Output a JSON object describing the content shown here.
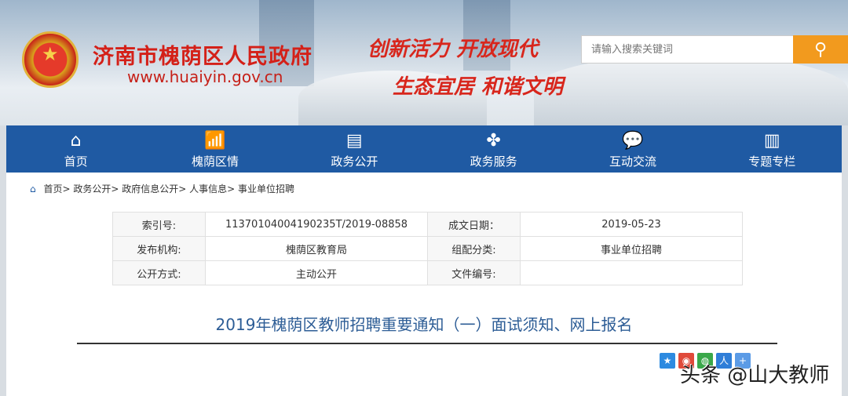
{
  "header": {
    "site_name": "济南市槐荫区人民政府",
    "url": "www.huaiyin.gov.cn",
    "slogan1": "创新活力  开放现代",
    "slogan2": "生态宜居  和谐文明",
    "search_placeholder": "请输入搜索关键词"
  },
  "nav": [
    {
      "label": "首页",
      "icon": "home-icon"
    },
    {
      "label": "槐荫区情",
      "icon": "chart-icon"
    },
    {
      "label": "政务公开",
      "icon": "document-icon"
    },
    {
      "label": "政务服务",
      "icon": "grid-icon"
    },
    {
      "label": "互动交流",
      "icon": "chat-icon"
    },
    {
      "label": "专题专栏",
      "icon": "bookmark-icon"
    }
  ],
  "breadcrumb": [
    "首页",
    "政务公开",
    "政府信息公开",
    "人事信息",
    "事业单位招聘"
  ],
  "info": {
    "index_label": "索引号:",
    "index_value": "11370104004190235T/2019-08858",
    "date_label": "成文日期：",
    "date_value": "2019-05-23",
    "org_label": "发布机构:",
    "org_value": "槐荫区教育局",
    "cat_label": "组配分类:",
    "cat_value": "事业单位招聘",
    "mode_label": "公开方式:",
    "mode_value": "主动公开",
    "doc_label": "文件编号:",
    "doc_value": ""
  },
  "article_title": "2019年槐荫区教师招聘重要通知（一）面试须知、网上报名",
  "watermark": "头条 @山大教师"
}
